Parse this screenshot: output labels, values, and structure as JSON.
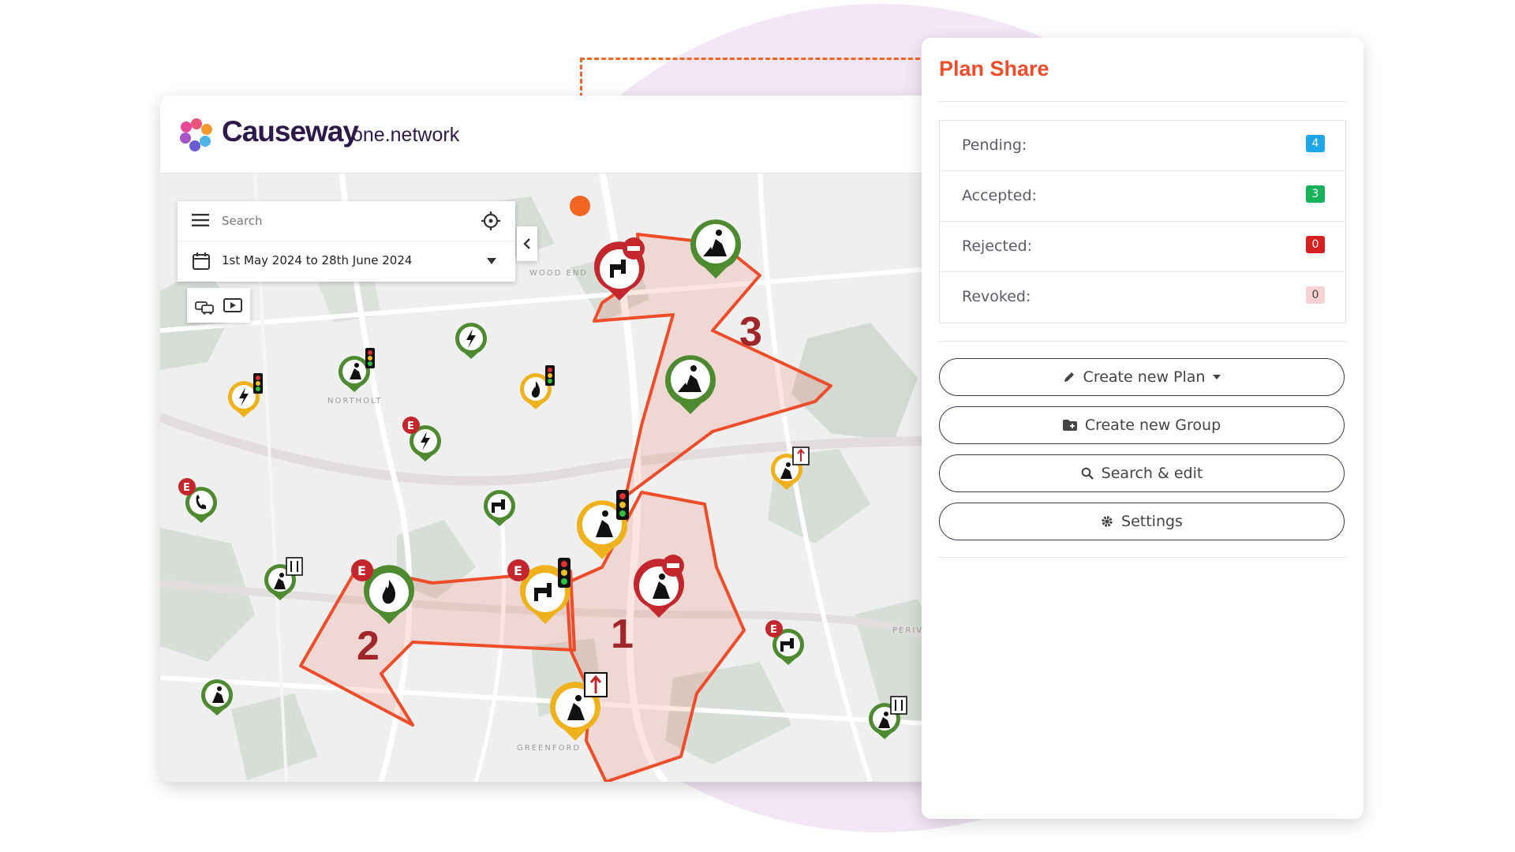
{
  "brand": {
    "name": "Causeway",
    "sub": "one.network"
  },
  "search": {
    "placeholder": "Search",
    "date_range": "1st May 2024 to 28th June 2024"
  },
  "map": {
    "areas": [
      "1",
      "2",
      "3"
    ],
    "streets": [
      "WOOD END",
      "NORTHOLT",
      "GREENFORD",
      "PERIV"
    ]
  },
  "plan_share": {
    "title": "Plan Share",
    "statuses": [
      {
        "label": "Pending:",
        "count": "4",
        "color": "#1ea7e8"
      },
      {
        "label": "Accepted:",
        "count": "3",
        "color": "#16b35a"
      },
      {
        "label": "Rejected:",
        "count": "0",
        "color": "#d81f1f"
      },
      {
        "label": "Revoked:",
        "count": "0",
        "color": "#f7d2d2"
      }
    ],
    "buttons": {
      "create_plan": "Create new Plan",
      "create_group": "Create new Group",
      "search_edit": "Search & edit",
      "settings": "Settings"
    }
  },
  "colors": {
    "accent": "#ef4c2a",
    "connector": "#f26522",
    "polygon": "#ef4c2a",
    "bg_circle": "#f3e6f6"
  }
}
